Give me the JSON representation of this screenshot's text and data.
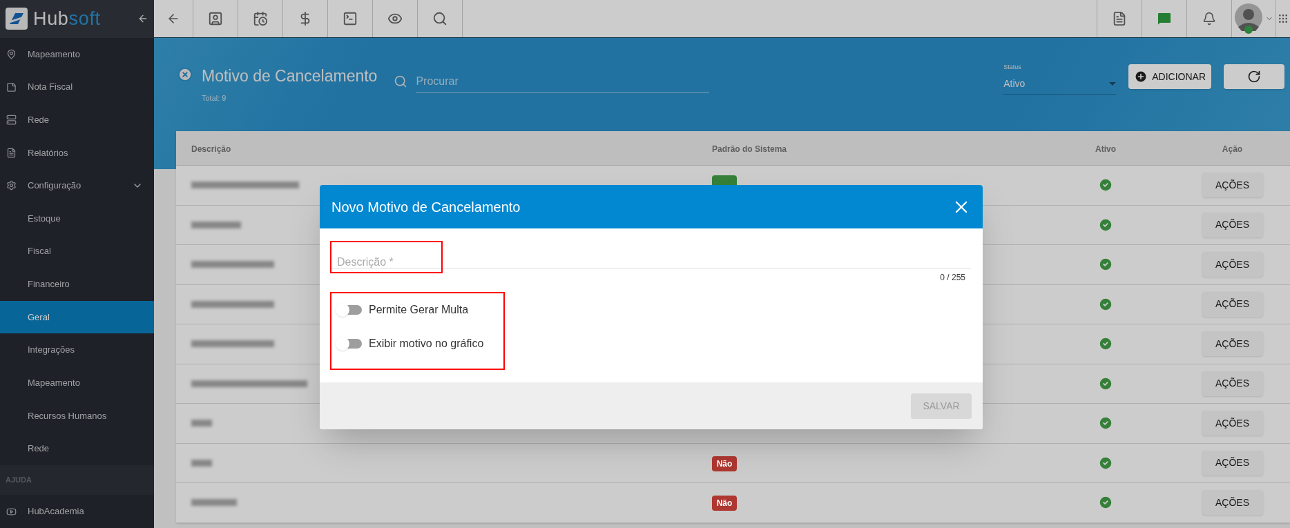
{
  "sidebar": {
    "logo": {
      "text_dark": "Hub",
      "text_accent": "soft"
    },
    "items": [
      {
        "kind": "main",
        "label": "Mapeamento",
        "selected": false
      },
      {
        "kind": "main",
        "label": "Nota Fiscal",
        "selected": false
      },
      {
        "kind": "main",
        "label": "Rede",
        "selected": false
      },
      {
        "kind": "main",
        "label": "Relatórios",
        "selected": false
      },
      {
        "kind": "main",
        "label": "Configuração",
        "selected": false,
        "expanded": true
      },
      {
        "kind": "sub",
        "label": "Estoque",
        "selected": false
      },
      {
        "kind": "sub",
        "label": "Fiscal",
        "selected": false
      },
      {
        "kind": "sub",
        "label": "Financeiro",
        "selected": false
      },
      {
        "kind": "sub",
        "label": "Geral",
        "selected": true
      },
      {
        "kind": "sub",
        "label": "Integrações",
        "selected": false
      },
      {
        "kind": "sub",
        "label": "Mapeamento",
        "selected": false
      },
      {
        "kind": "sub",
        "label": "Recursos Humanos",
        "selected": false
      },
      {
        "kind": "sub",
        "label": "Rede",
        "selected": false
      },
      {
        "kind": "header",
        "label": "AJUDA"
      },
      {
        "kind": "main",
        "label": "HubAcademia",
        "selected": false
      }
    ]
  },
  "page": {
    "title": "Motivo de Cancelamento",
    "total": "Total: 9",
    "search": {
      "placeholder": "Procurar"
    },
    "status": {
      "label": "Status",
      "value": "Ativo"
    },
    "add_button": "ADICIONAR"
  },
  "table": {
    "columns": [
      "Descrição",
      "Padrão do Sistema",
      "Ativo",
      "Ação"
    ],
    "rows": [
      {
        "padrao": {
          "color": "#368039"
        },
        "ativo": true,
        "action": "AÇÕES"
      },
      {
        "ativo": true,
        "action": "AÇÕES"
      },
      {
        "ativo": true,
        "action": "AÇÕES"
      },
      {
        "ativo": true,
        "action": "AÇÕES"
      },
      {
        "ativo": true,
        "action": "AÇÕES"
      },
      {
        "ativo": true,
        "action": "AÇÕES"
      },
      {
        "ativo": true,
        "action": "AÇÕES"
      },
      {
        "padrao": {
          "text": "Não",
          "color": "#ae3731"
        },
        "ativo": true,
        "action": "AÇÕES"
      },
      {
        "padrao": {
          "text": "Não",
          "color": "#ae3731"
        },
        "ativo": true,
        "action": "AÇÕES"
      }
    ]
  },
  "dialog": {
    "title": "Novo Motivo de Cancelamento",
    "field": {
      "placeholder": "Descrição *",
      "counter": "0 / 255",
      "highlighted": true
    },
    "toggles_highlighted": true,
    "toggles": [
      {
        "label": "Permite Gerar Multa",
        "on": false
      },
      {
        "label": "Exibir motivo no gráfico",
        "on": false
      }
    ],
    "save_button": {
      "label": "SALVAR",
      "disabled": true
    }
  }
}
